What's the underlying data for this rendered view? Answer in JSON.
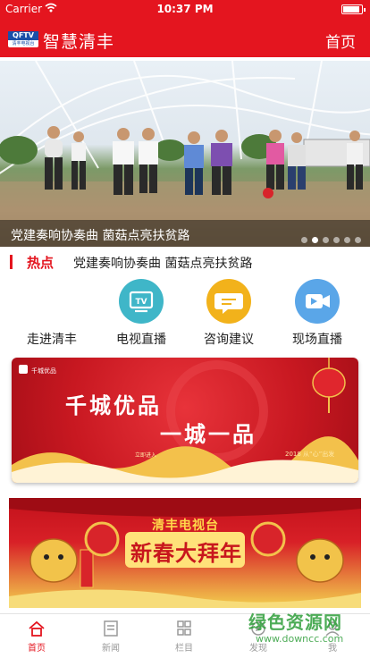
{
  "status_bar": {
    "carrier": "Carrier",
    "wifi_icon": "wifi-icon",
    "time": "10:37 PM",
    "battery_level": 0.9
  },
  "header": {
    "logo_top": "QFTV",
    "logo_bottom": "清丰电视台",
    "title": "智慧清丰",
    "home_label": "首页"
  },
  "banner": {
    "caption": "党建奏响协奏曲 菌菇点亮扶贫路",
    "dots": 6,
    "active_dot": 1
  },
  "hot": {
    "label": "热点",
    "text": "党建奏响协奏曲 菌菇点亮扶贫路"
  },
  "quick_nav": [
    {
      "label": "走进清丰",
      "icon": "building-icon",
      "color": "#ffffff"
    },
    {
      "label": "电视直播",
      "icon": "tv-icon",
      "color": "#3fb6c8"
    },
    {
      "label": "咨询建议",
      "icon": "chat-icon",
      "color": "#f2b21b"
    },
    {
      "label": "现场直播",
      "icon": "video-camera-icon",
      "color": "#5aa6e8"
    }
  ],
  "promo1": {
    "brand": "千城优品",
    "title": "千城优品",
    "subtitle": "一城一品",
    "enter": "立即进入",
    "date": "2018 从“心”出发"
  },
  "promo2": {
    "station": "清丰电视台",
    "title": "新春大拜年"
  },
  "tabbar": [
    {
      "label": "首页",
      "icon": "home-icon",
      "active": true
    },
    {
      "label": "新闻",
      "icon": "news-icon",
      "active": false
    },
    {
      "label": "栏目",
      "icon": "grid-icon",
      "active": false
    },
    {
      "label": "发现",
      "icon": "discover-icon",
      "active": false
    },
    {
      "label": "我",
      "icon": "user-icon",
      "active": false
    }
  ],
  "watermark": {
    "line1": "绿色资源网",
    "line2": "www.downcc.com"
  },
  "colors": {
    "brand_red": "#e4151f"
  }
}
